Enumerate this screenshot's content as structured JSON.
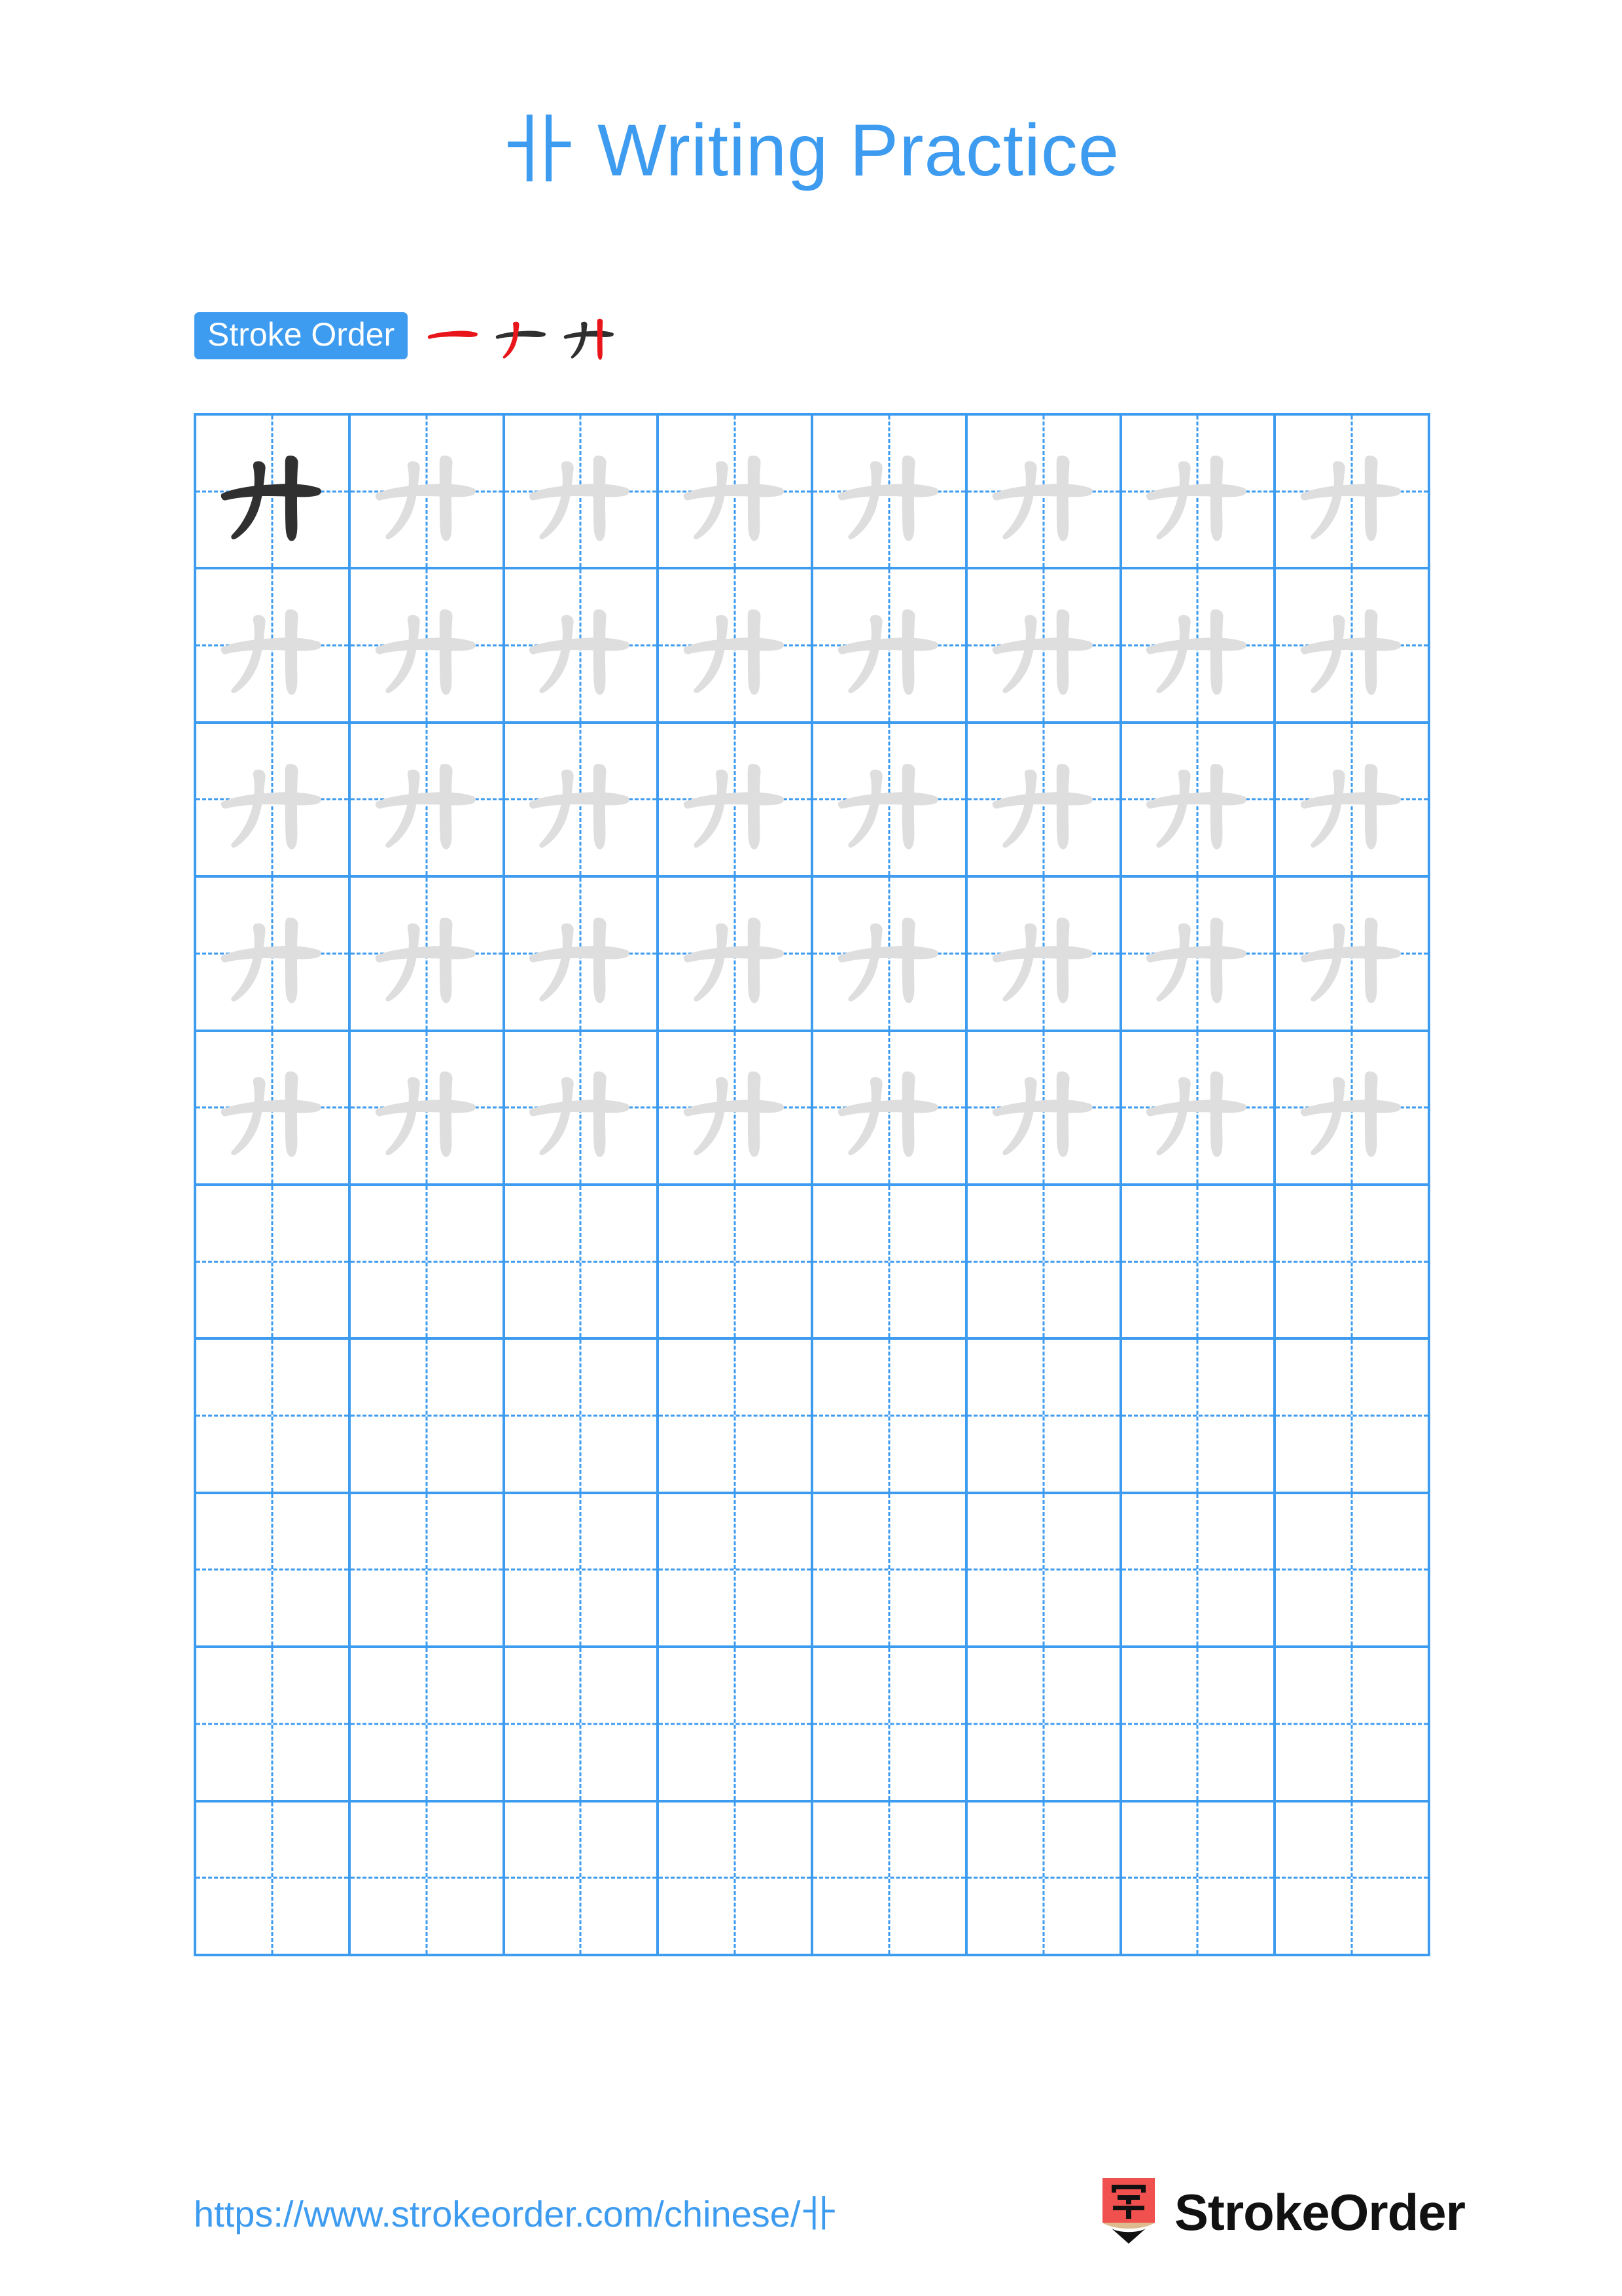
{
  "meta": {
    "character": "卝",
    "page_kind": "chinese-character-writing-practice-worksheet"
  },
  "header": {
    "title_character": "卝",
    "title_text": " Writing Practice",
    "title_full": "卝 Writing Practice",
    "title_color": "#3d9bf0"
  },
  "stroke_order": {
    "badge_label": "Stroke Order",
    "badge_bg": "#3d9bf0",
    "badge_text_color": "#ffffff",
    "new_stroke_color": "#e8161a",
    "done_stroke_color": "#303030",
    "stroke_count": 3,
    "steps": [
      {
        "index": 1,
        "new_stroke": "heng (horizontal)",
        "strokes_shown": 1
      },
      {
        "index": 2,
        "new_stroke": "pie (left-falling)",
        "strokes_shown": 2
      },
      {
        "index": 3,
        "new_stroke": "shu (vertical)",
        "strokes_shown": 3
      }
    ]
  },
  "grid": {
    "columns": 8,
    "rows": 10,
    "line_color": "#3d9bf0",
    "dark_glyph_color": "#303030",
    "light_glyph_color": "#dedede",
    "cells": [
      [
        "dark",
        "light",
        "light",
        "light",
        "light",
        "light",
        "light",
        "light"
      ],
      [
        "light",
        "light",
        "light",
        "light",
        "light",
        "light",
        "light",
        "light"
      ],
      [
        "light",
        "light",
        "light",
        "light",
        "light",
        "light",
        "light",
        "light"
      ],
      [
        "light",
        "light",
        "light",
        "light",
        "light",
        "light",
        "light",
        "light"
      ],
      [
        "light",
        "light",
        "light",
        "light",
        "light",
        "light",
        "light",
        "light"
      ],
      [
        "empty",
        "empty",
        "empty",
        "empty",
        "empty",
        "empty",
        "empty",
        "empty"
      ],
      [
        "empty",
        "empty",
        "empty",
        "empty",
        "empty",
        "empty",
        "empty",
        "empty"
      ],
      [
        "empty",
        "empty",
        "empty",
        "empty",
        "empty",
        "empty",
        "empty",
        "empty"
      ],
      [
        "empty",
        "empty",
        "empty",
        "empty",
        "empty",
        "empty",
        "empty",
        "empty"
      ],
      [
        "empty",
        "empty",
        "empty",
        "empty",
        "empty",
        "empty",
        "empty",
        "empty"
      ]
    ]
  },
  "footer": {
    "url": "https://www.strokeorder.com/chinese/卝",
    "url_color": "#3d9bf0",
    "brand_name": "StrokeOrder",
    "logo_character": "字",
    "logo_body_color": "#f0504e",
    "logo_wood_color": "#ddbb8e",
    "logo_tip_color": "#111111"
  }
}
